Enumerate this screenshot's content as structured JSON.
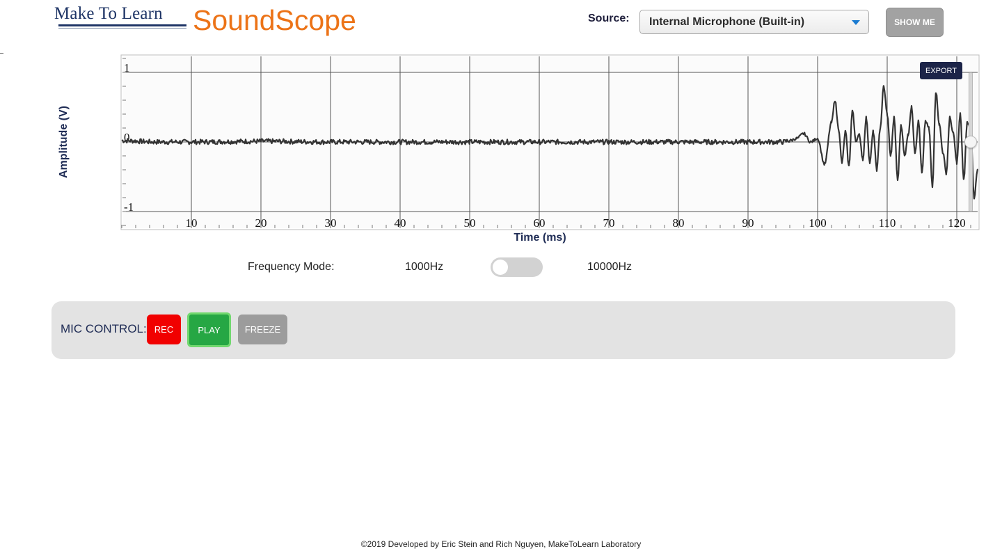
{
  "header": {
    "logo_text": "Make To Learn",
    "app_title": "SoundScope",
    "source_label": "Source:",
    "source_selected": "Internal Microphone (Built-in)",
    "show_me_label": "SHOW ME"
  },
  "chart": {
    "export_label": "EXPORT"
  },
  "chart_data": {
    "type": "line",
    "title": "",
    "xlabel": "Time (ms)",
    "ylabel": "Amplitude (V)",
    "xlim": [
      0,
      123
    ],
    "ylim": [
      -1.25,
      1.25
    ],
    "x_ticks": [
      10,
      20,
      30,
      40,
      50,
      60,
      70,
      80,
      90,
      100,
      110,
      120
    ],
    "y_ticks": [
      1,
      0,
      -1
    ],
    "grid": true,
    "line_color": "#333333",
    "series": [
      {
        "x": [
          0,
          5,
          10,
          20,
          30,
          40,
          50,
          60,
          70,
          80,
          90,
          95,
          96,
          97,
          98,
          99,
          100,
          101,
          102,
          102.5,
          103,
          103.5,
          104,
          104.5,
          105,
          105.5,
          106,
          106.5,
          107,
          107.5,
          108,
          108.5,
          109,
          109.5,
          110,
          110.5,
          111,
          111.5,
          112,
          112.5,
          113,
          113.5,
          114,
          114.5,
          115,
          115.5,
          116,
          116.5,
          117,
          117.5,
          118,
          118.5,
          119,
          119.5,
          120,
          120.5,
          121,
          121.5,
          122,
          122.5,
          123
        ],
        "y": [
          0.02,
          0.0,
          0.0,
          0.01,
          0.0,
          0.0,
          0.0,
          0.0,
          0.0,
          0.0,
          0.0,
          0.0,
          0.02,
          0.05,
          0.12,
          0.0,
          0.05,
          -0.32,
          0.28,
          0.6,
          0.2,
          -0.3,
          0.15,
          -0.35,
          0.45,
          0.02,
          0.1,
          -0.25,
          0.35,
          -0.3,
          0.15,
          -0.4,
          0.2,
          0.8,
          0.4,
          -0.2,
          0.35,
          -0.55,
          0.25,
          -0.2,
          0.1,
          0.5,
          -0.15,
          0.3,
          -0.45,
          0.3,
          0.2,
          -0.65,
          0.72,
          0.25,
          -0.15,
          -0.45,
          0.35,
          0.12,
          -0.3,
          0.4,
          -0.55,
          0.28,
          0.2,
          -0.8,
          -0.4
        ]
      }
    ]
  },
  "frequency": {
    "label": "Frequency Mode:",
    "low": "1000Hz",
    "high": "10000Hz",
    "toggle_on": false
  },
  "mic": {
    "label": "MIC CONTROL:",
    "rec": "REC",
    "play": "PLAY",
    "freeze": "FREEZE"
  },
  "footer": {
    "text": "©2019 Developed by Eric Stein and Rich Nguyen, MakeToLearn Laboratory"
  }
}
